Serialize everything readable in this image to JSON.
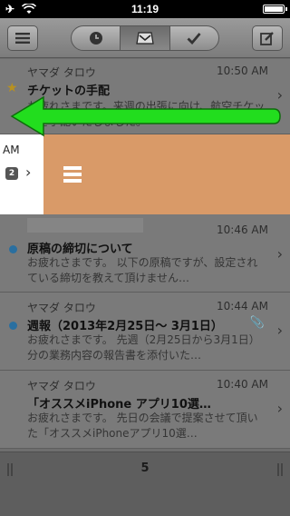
{
  "status_bar": {
    "time": "11:19"
  },
  "toolbar": {
    "menu_icon": "list-icon",
    "segments": [
      "clock-icon",
      "inbox-tray-icon",
      "checkmark-icon"
    ],
    "compose_icon": "compose-icon"
  },
  "emails": [
    {
      "sender": "ヤマダ タロウ",
      "time": "10:50 AM",
      "subject": "チケットの手配",
      "preview": "お疲れさまです。来週の出張に向け、航空チケットを手配いたしました。",
      "starred": true
    },
    {
      "sender": "",
      "time": "10:46 AM",
      "subject": "原稿の締切について",
      "preview": "お疲れさまです。 以下の原稿ですが、設定されている締切を教えて頂けません…",
      "unread": true
    },
    {
      "sender": "ヤマダ タロウ",
      "time": "10:44 AM",
      "subject": "週報（2013年2月25日～ 3月1日）",
      "preview": "お疲れさまです。 先週（2月25日から3月1日）分の業務内容の報告書を添付いた…",
      "unread": true,
      "attachment": true
    },
    {
      "sender": "ヤマダ タロウ",
      "time": "10:40 AM",
      "subject": "「オススメiPhone アプリ10選…",
      "preview": "お疲れさまです。 先日の会議で提案させて頂いた「オススメiPhoneアプリ10選…"
    }
  ],
  "swipe_row": {
    "time_fragment": "AM",
    "thread_count": "2",
    "action_icon": "list-icon",
    "color": "#d99a68"
  },
  "footer": {
    "count": "5"
  },
  "colors": {
    "arrow": "#22dd1e",
    "unread_dot": "#2a6fa0",
    "star": "#b8911f"
  }
}
